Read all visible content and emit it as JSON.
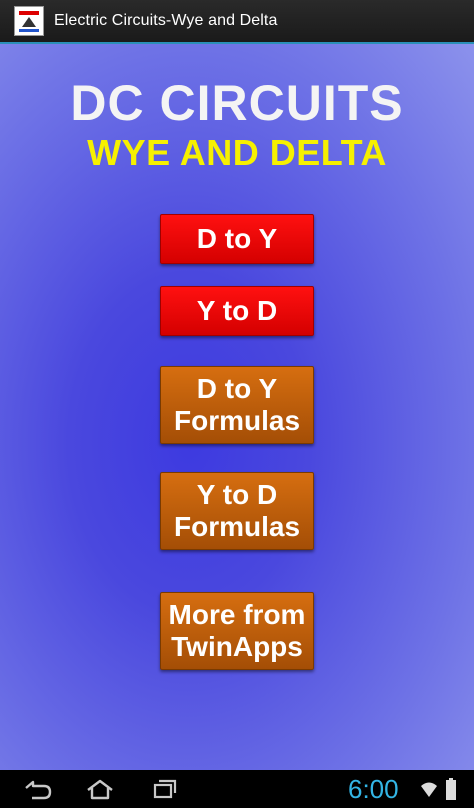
{
  "window": {
    "title": "Electric Circuits-Wye and Delta"
  },
  "heading": {
    "line1": "DC CIRCUITS",
    "line2": "WYE AND DELTA"
  },
  "buttons": [
    {
      "line1": "D to Y",
      "line2": ""
    },
    {
      "line1": "Y to D",
      "line2": ""
    },
    {
      "line1": "D to Y",
      "line2": "Formulas"
    },
    {
      "line1": "Y to D",
      "line2": "Formulas"
    },
    {
      "line1": "More from",
      "line2": "TwinApps"
    }
  ],
  "status": {
    "time": "6:00"
  },
  "colors": {
    "accent": "#33b5e5",
    "button_red": "#e60000",
    "button_orange": "#c0600a",
    "heading_yellow": "#f6f000",
    "background_blue": "#4a48de"
  },
  "icons": {
    "back": "back-icon",
    "home": "home-icon",
    "recent": "recent-apps-icon",
    "wifi": "wifi-icon",
    "battery": "battery-icon",
    "app": "app-icon"
  }
}
